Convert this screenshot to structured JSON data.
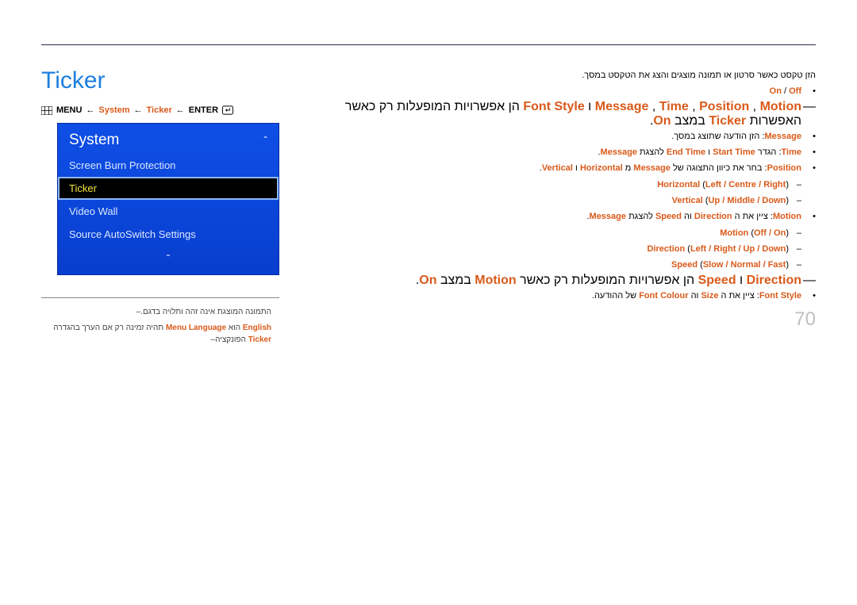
{
  "title": "Ticker",
  "breadcrumb": {
    "menu_label": "MENU",
    "system_label": "System",
    "ticker_label": "Ticker",
    "enter_label": "ENTER"
  },
  "menu_panel": {
    "header": "System",
    "items": [
      {
        "label": "Screen Burn Protection",
        "selected": false
      },
      {
        "label": "Ticker",
        "selected": true
      },
      {
        "label": "Video Wall",
        "selected": false
      },
      {
        "label": "Source AutoSwitch Settings",
        "selected": false
      }
    ]
  },
  "notes": {
    "n1_text": "התמונה המוצגת אינה זהה ותלויה בדגם.",
    "n2_part1": "הפונקציה",
    "n2_ticker": "Ticker",
    "n2_part2": "תהיה זמינה רק אם הערך בהגדרה",
    "n2_ml": "Menu Language",
    "n2_part3": "הוא",
    "n2_en": "English"
  },
  "intro": "הזן טקסט כאשר סרטון או תמונה מוצגים והצג את הטקסט במסך.",
  "b_onoff": {
    "on": "On",
    "slash": " / ",
    "off": "Off"
  },
  "b_dash1": {
    "keys": "Message",
    "sep1": " ,",
    "k2": "Time",
    "sep2": " ,",
    "k3": "Position",
    "sep3": " ,",
    "k4": "Motion",
    "sep4": " ו",
    "k5": "Font Style",
    "text_mid": " הן אפשרויות המופעלות רק כאשר האפשרות ",
    "ticker": "Ticker",
    "text_end": " במצב ",
    "on": "On",
    "dot": "."
  },
  "b_message": {
    "key": "Message",
    "text": ": הזן הודעה שתוצג במסך."
  },
  "b_time": {
    "key": "Time",
    "text1": ": הגדר ",
    "k2": "Start Time",
    "sep": " ו",
    "k3": "End Time",
    "text2": " להצגת ",
    "k4": "Message",
    "dot": "."
  },
  "b_position": {
    "key": "Position",
    "text1": ": בחר את כיוון התצוגה של ",
    "k2": "Message",
    "sep": " מ",
    "k3": "Horizontal",
    "sep2": " ו",
    "k4": "Vertical",
    "dot": "."
  },
  "sub_h": {
    "key": "Horizontal",
    "vals": "Left / Centre / Right",
    "open": " (",
    "close": ")"
  },
  "sub_v": {
    "key": "Vertical",
    "vals": "Up / Middle / Down",
    "open": " (",
    "close": ")"
  },
  "b_motion": {
    "key": "Motion",
    "text1": ": ציין את ה",
    "k2": "Direction",
    "sep": " וה",
    "k3": "Speed",
    "text2": " להצגת ",
    "k4": "Message",
    "dot": "."
  },
  "sub_m1": {
    "key": "Motion",
    "vals": "Off / On",
    "open": " (",
    "close": ")"
  },
  "sub_m2": {
    "key": "Direction",
    "vals": "Left / Right / Up / Down",
    "open": " (",
    "close": ")"
  },
  "sub_m3": {
    "key": "Speed",
    "vals": "Slow / Normal / Fast",
    "open": " (",
    "close": ")"
  },
  "b_dash2": {
    "k1": "Direction",
    "sep": " ו",
    "k2": "Speed",
    "text_mid": " הן אפשרויות המופעלות רק כאשר ",
    "k3": "Motion",
    "text_end": " במצב ",
    "on": "On",
    "dot": "."
  },
  "b_font": {
    "key": "Font Style",
    "text1": ": ציין את ה",
    "k2": "Size",
    "sep": " וה",
    "k3": "Font Colour",
    "text2": " של ההודעה."
  },
  "page_number": "70"
}
